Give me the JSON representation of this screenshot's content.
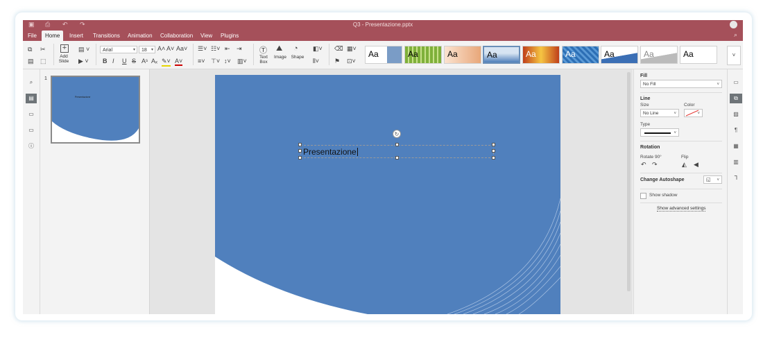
{
  "window": {
    "title": "Q3 - Presentazione.pptx"
  },
  "menu": {
    "tabs": [
      "File",
      "Home",
      "Insert",
      "Transitions",
      "Animation",
      "Collaboration",
      "View",
      "Plugins"
    ],
    "active": "Home"
  },
  "toolbar": {
    "add_slide_label": "Add Slide",
    "font_name": "Arial",
    "font_size": "18",
    "text_box_label": "Text Box",
    "image_label": "Image",
    "shape_label": "Shape",
    "theme_sample": "Aa"
  },
  "slides": {
    "numbers": [
      "1"
    ],
    "thumb_title": "Presentazione"
  },
  "slide": {
    "title_text": "Presentazione"
  },
  "panel": {
    "fill_heading": "Fill",
    "fill_value": "No Fill",
    "line_heading": "Line",
    "size_label": "Size",
    "color_label": "Color",
    "size_value": "No Line",
    "type_label": "Type",
    "rotation_heading": "Rotation",
    "rotate_label": "Rotate 90°",
    "flip_label": "Flip",
    "autoshape_label": "Change Autoshape",
    "shadow_label": "Show shadow",
    "advanced_label": "Show advanced settings"
  },
  "colors": {
    "accent": "#a5505a",
    "slide_blue": "#5080bd"
  }
}
